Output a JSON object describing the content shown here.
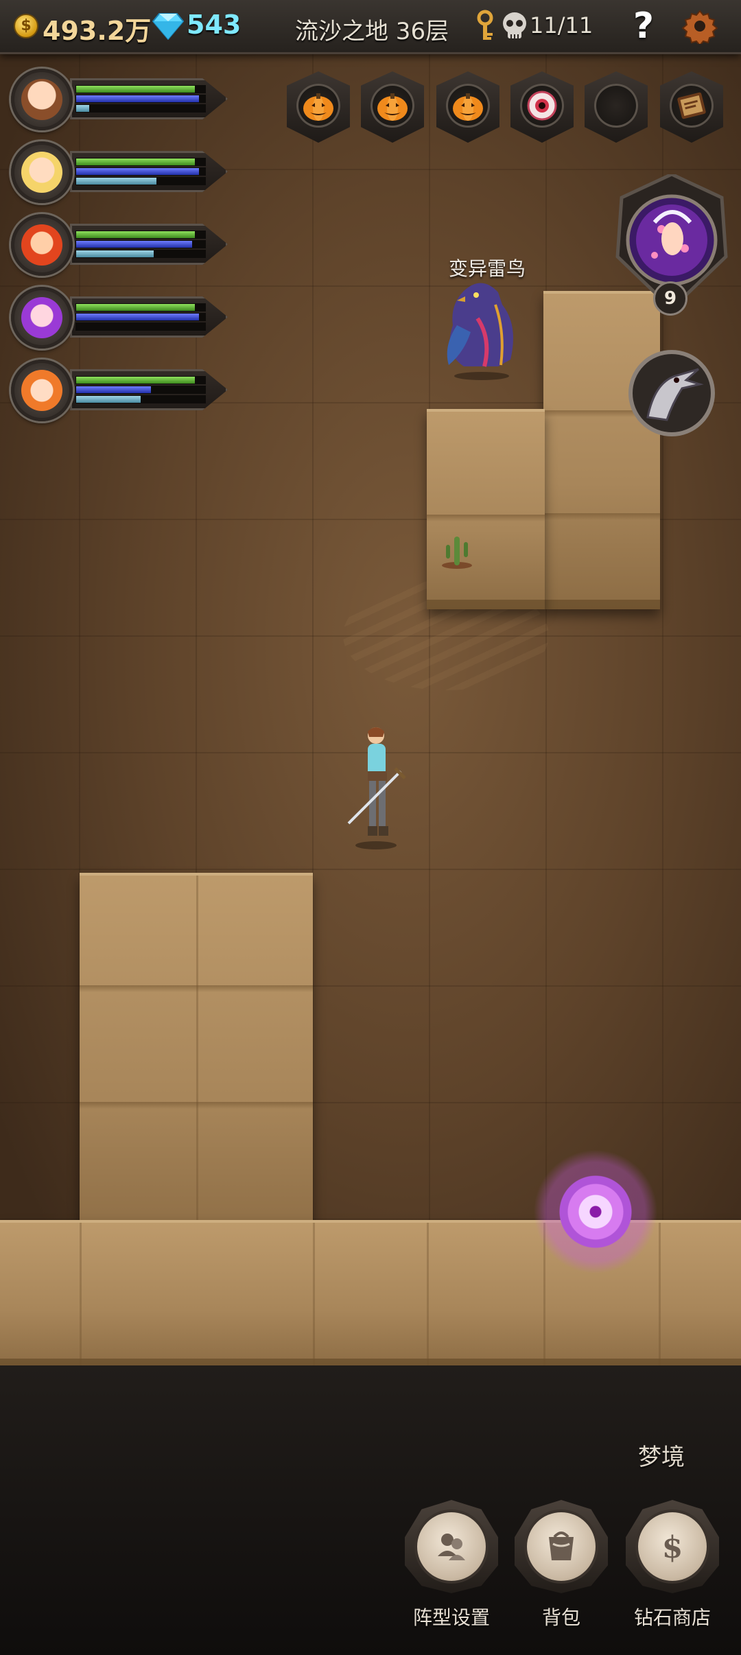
{
  "topbar": {
    "gold": "493.2万",
    "gems": "543",
    "floor_title": "流沙之地 36层",
    "kills": "11/11",
    "help_symbol": "?",
    "coin_symbol": "$"
  },
  "party": [
    {
      "portrait": "hero-brown-hair",
      "hp": 0.92,
      "mp": 0.95,
      "xp": 0.1
    },
    {
      "portrait": "hero-blonde",
      "hp": 0.92,
      "mp": 0.95,
      "xp": 0.62
    },
    {
      "portrait": "hero-red-fire",
      "hp": 0.92,
      "mp": 0.9,
      "xp": 0.6
    },
    {
      "portrait": "hero-purple-hair",
      "hp": 0.92,
      "mp": 0.95,
      "xp": 0.0
    },
    {
      "portrait": "hero-orange-hat",
      "hp": 0.92,
      "mp": 0.58,
      "xp": 0.5
    }
  ],
  "buff_slots": [
    "pumpkin-icon",
    "pumpkin-icon",
    "pumpkin-icon",
    "eye-icon",
    "empty-slot",
    "book-icon"
  ],
  "boss": {
    "level": "9",
    "icon": "boss-cupid-icon"
  },
  "enemy": {
    "name": "变异雷鸟"
  },
  "bottom": {
    "dream_label": "梦境",
    "buttons": [
      {
        "label": "阵型设置",
        "icon": "formation-icon"
      },
      {
        "label": "背包",
        "icon": "bag-icon"
      },
      {
        "label": "钻石商店",
        "icon": "dollar-icon"
      }
    ]
  },
  "colors": {
    "gold_text": "#f3d69a",
    "gem_text": "#7fe9ff",
    "hp_bar": "#5cbf2c",
    "mp_bar": "#3342d0",
    "xp_bar": "#7fbad0",
    "portal": "#d77bf0"
  }
}
